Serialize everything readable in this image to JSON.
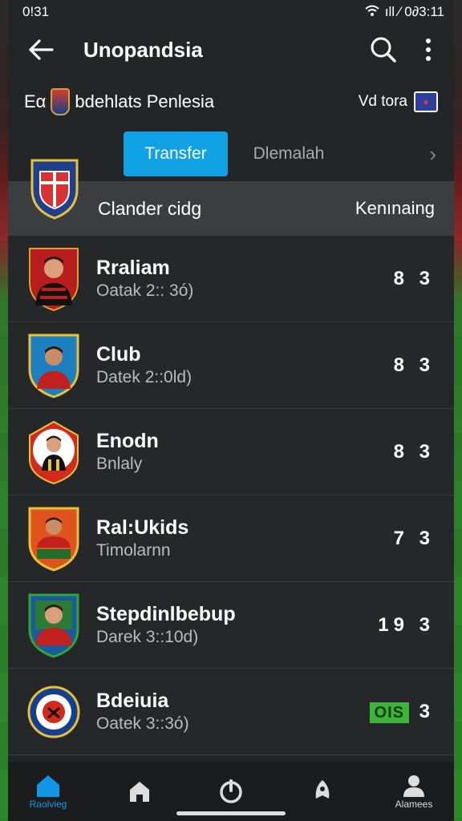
{
  "status": {
    "time": "0!31",
    "right_text": "ıll ⁄ 0∂3:11"
  },
  "appbar": {
    "title": "Unopandsia"
  },
  "subheader": {
    "left_prefix": "Eα",
    "left_text": "bdehlats Penlesia",
    "right_text": "Vd tora"
  },
  "tabs": [
    {
      "label": "Transfer",
      "active": true
    },
    {
      "label": "Dlemalah",
      "active": false
    }
  ],
  "table_header": {
    "col1": "Cland​er cidg",
    "col2": "Kenınaing"
  },
  "rows": [
    {
      "name": "Rraliam",
      "sub": "Oatak 2:: 3ó)",
      "value": "8 3",
      "crest_color": "#b81c1c"
    },
    {
      "name": "Club",
      "sub": "Datek 2::0ld)",
      "value": "8 3",
      "crest_color": "#1c7fbf"
    },
    {
      "name": "Enodn",
      "sub": "Bnlaly",
      "value": "8 3",
      "crest_color": "#d22a1c"
    },
    {
      "name": "Ral:Ukids",
      "sub": "Timolarnn",
      "value": "7 3",
      "crest_color": "#e0531c"
    },
    {
      "name": "Stepdinlbebup",
      "sub": "Darek 3::10d)",
      "value": "19 3",
      "crest_color": "#1c5a9e"
    },
    {
      "name": "Bdeiuia",
      "sub": "Oatek 3::3ó)",
      "value": "3",
      "badge": "OIS",
      "crest_color": "#153e8c"
    }
  ],
  "bottom_nav": [
    {
      "label": "Raolvieg",
      "icon": "home-icon",
      "active": true
    },
    {
      "label": "",
      "icon": "house-icon",
      "active": false
    },
    {
      "label": "",
      "icon": "power-icon",
      "active": false
    },
    {
      "label": "",
      "icon": "rocket-icon",
      "active": false
    },
    {
      "label": "Alamees",
      "icon": "user-icon",
      "active": false
    }
  ]
}
